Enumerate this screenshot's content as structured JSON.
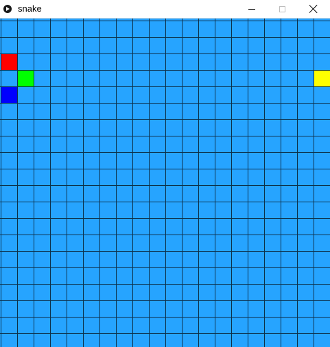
{
  "window": {
    "title": "snake",
    "icon": "play-circle-icon",
    "controls": [
      "minimize-icon",
      "maximize-icon",
      "close-icon"
    ]
  },
  "board": {
    "columns": 20,
    "rows": 20,
    "background_color": "#26a4ff",
    "grid_line_color": "#0d2f4a",
    "cells": [
      {
        "name": "red-square",
        "col": 0,
        "row": 2,
        "color": "#ff0000"
      },
      {
        "name": "green-square",
        "col": 1,
        "row": 3,
        "color": "#00ff00"
      },
      {
        "name": "blue-square",
        "col": 0,
        "row": 4,
        "color": "#0000ff"
      },
      {
        "name": "yellow-square",
        "col": 19,
        "row": 3,
        "color": "#ffff00"
      }
    ]
  }
}
